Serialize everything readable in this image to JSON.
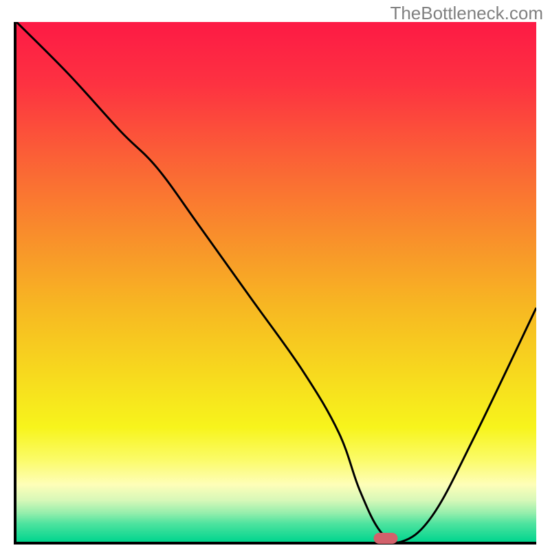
{
  "watermark": "TheBottleneck.com",
  "chart_data": {
    "type": "line",
    "title": "",
    "xlabel": "",
    "ylabel": "",
    "xlim": [
      0,
      100
    ],
    "ylim": [
      0,
      100
    ],
    "series": [
      {
        "name": "bottleneck-curve",
        "x": [
          0,
          10,
          20,
          27,
          35,
          45,
          55,
          62,
          66,
          70,
          74,
          80,
          88,
          100
        ],
        "y": [
          100,
          90,
          79,
          72,
          61,
          47,
          33,
          21,
          10,
          2,
          0,
          5,
          20,
          45
        ]
      }
    ],
    "marker": {
      "x": 71,
      "y": 0,
      "color": "#d2616b"
    },
    "gradient_stops": [
      {
        "pct": 0,
        "color": "#fd1a45"
      },
      {
        "pct": 12,
        "color": "#fd3241"
      },
      {
        "pct": 25,
        "color": "#fb5d37"
      },
      {
        "pct": 40,
        "color": "#f98b2c"
      },
      {
        "pct": 55,
        "color": "#f7b822"
      },
      {
        "pct": 68,
        "color": "#f7da1e"
      },
      {
        "pct": 78,
        "color": "#f7f41c"
      },
      {
        "pct": 84,
        "color": "#fbfb65"
      },
      {
        "pct": 89,
        "color": "#fefeb8"
      },
      {
        "pct": 92,
        "color": "#d7f8b8"
      },
      {
        "pct": 94.5,
        "color": "#94eeac"
      },
      {
        "pct": 96.5,
        "color": "#4ee39f"
      },
      {
        "pct": 100,
        "color": "#01d58e"
      }
    ]
  }
}
